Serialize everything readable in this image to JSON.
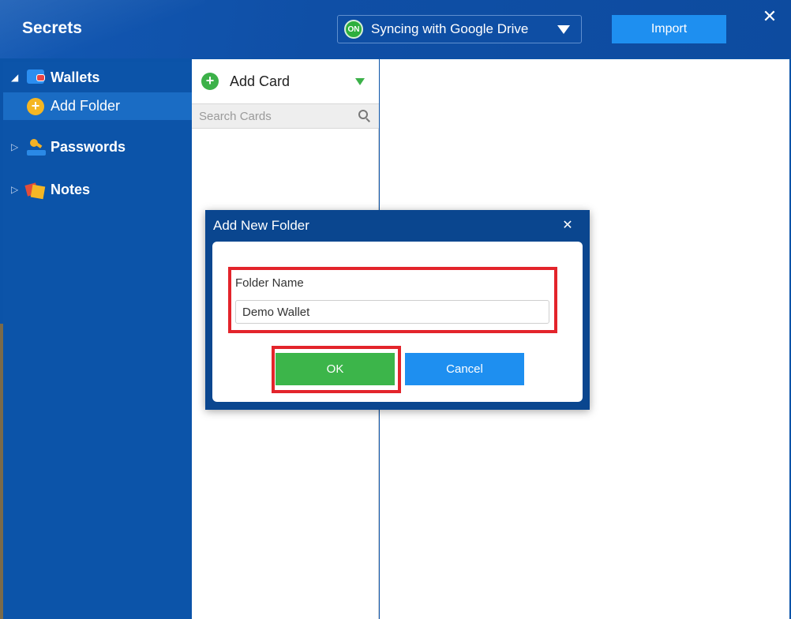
{
  "app": {
    "title": "Secrets",
    "accent": "#0c54a9",
    "close_icon": "close-icon"
  },
  "sync": {
    "status_badge": "ON",
    "label": "Syncing with Google Drive",
    "status_color": "#2eaf3d"
  },
  "toolbar": {
    "import_label": "Import",
    "import_color": "#1e8ff0"
  },
  "sidebar": {
    "items": [
      {
        "label": "Wallets",
        "icon": "wallet-icon",
        "expanded": true
      },
      {
        "label": "Add Folder",
        "icon": "add-folder-icon",
        "selected": true
      },
      {
        "label": "Passwords",
        "icon": "key-icon",
        "expanded": false
      },
      {
        "label": "Notes",
        "icon": "notes-icon",
        "expanded": false
      }
    ]
  },
  "cards": {
    "add_label": "Add Card",
    "search_placeholder": "Search Cards"
  },
  "dialog": {
    "title": "Add New Folder",
    "field_label": "Folder Name",
    "field_value": "Demo Wallet",
    "ok_label": "OK",
    "cancel_label": "Cancel",
    "ok_color": "#3cb54a",
    "cancel_color": "#1e8ff0",
    "highlight_color": "#e3242b"
  }
}
